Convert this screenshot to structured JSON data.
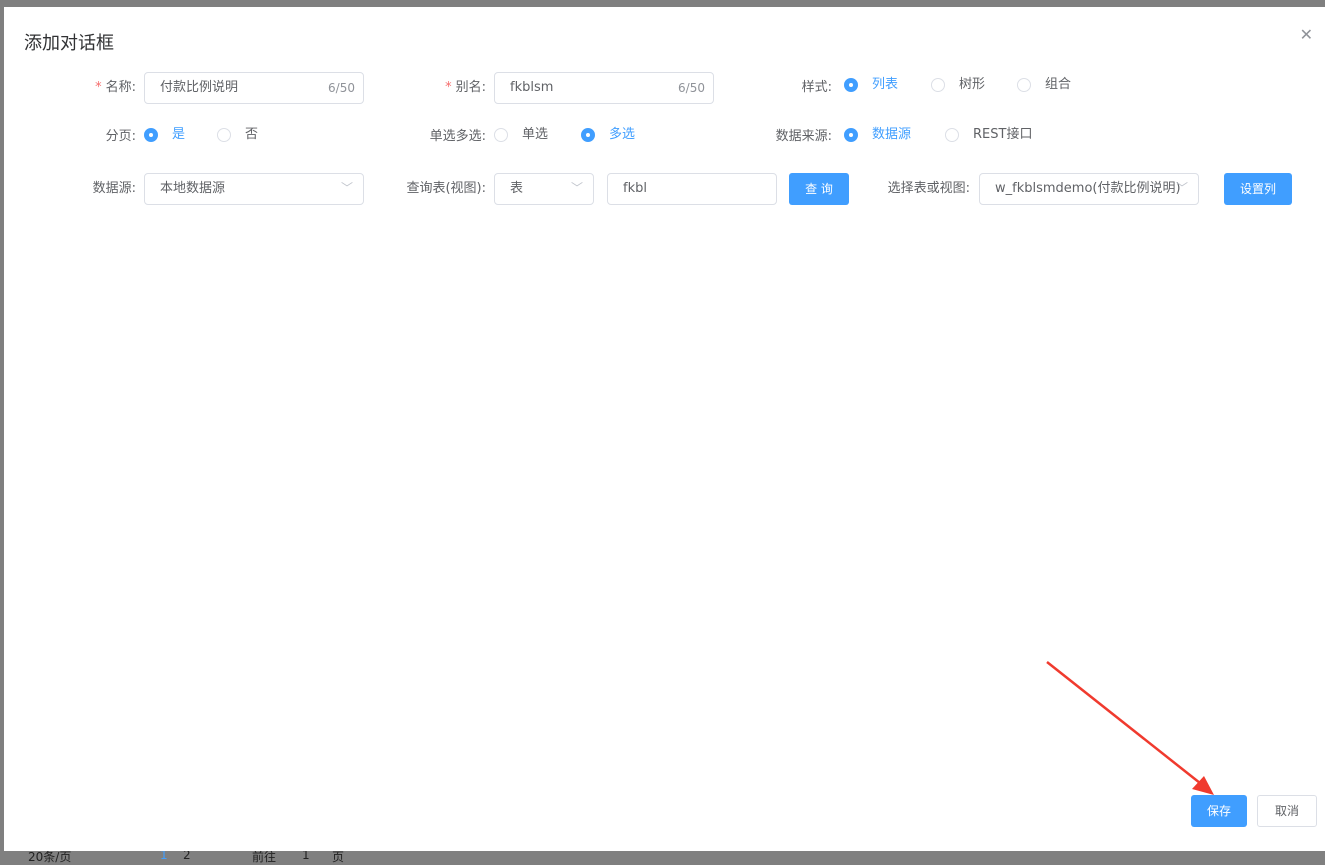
{
  "background_pager": {
    "page_size": "20条/页",
    "pages": [
      "1",
      "2"
    ],
    "goto": "前往",
    "goto_value": "1",
    "page_unit": "页"
  },
  "dialog": {
    "title": "添加对话框",
    "name": {
      "label": "名称:",
      "value": "付款比例说明",
      "count": "6/50"
    },
    "alias": {
      "label": "别名:",
      "value": "fkblsm",
      "count": "6/50"
    },
    "style": {
      "label": "样式:",
      "options": [
        "列表",
        "树形",
        "组合"
      ],
      "selected": 0
    },
    "paging": {
      "label": "分页:",
      "options": [
        "是",
        "否"
      ],
      "selected": 0
    },
    "select_mode": {
      "label": "单选多选:",
      "options": [
        "单选",
        "多选"
      ],
      "selected": 1
    },
    "data_source_type": {
      "label": "数据来源:",
      "options": [
        "数据源",
        "REST接口"
      ],
      "selected": 0
    },
    "datasource": {
      "label": "数据源:",
      "value": "本地数据源"
    },
    "query_table": {
      "label": "查询表(视图):",
      "type_value": "表",
      "keyword": "fkbl",
      "query_button": "查 询"
    },
    "table_view": {
      "label": "选择表或视图:",
      "value": "w_fkblsmdemo(付款比例说明)",
      "set_columns_button": "设置列"
    },
    "save_button": "保存",
    "cancel_button": "取消"
  }
}
